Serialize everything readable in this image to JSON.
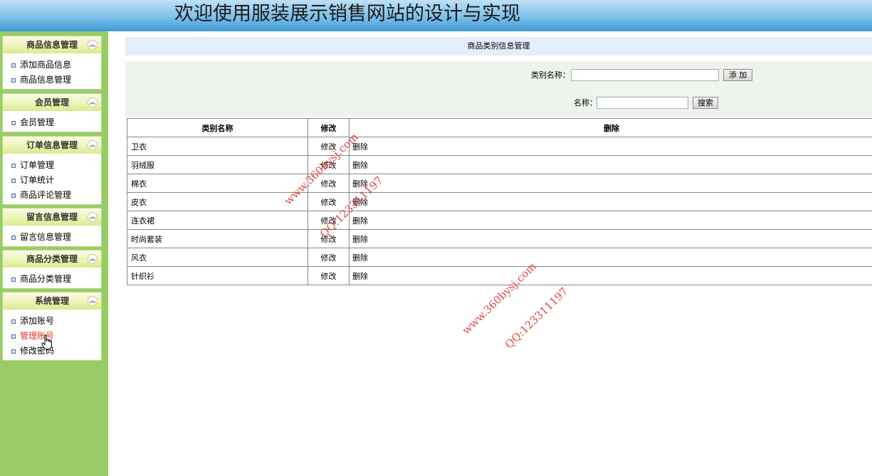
{
  "header": {
    "title": "欢迎使用服装展示销售网站的设计与实现"
  },
  "sidebar": {
    "groups": [
      {
        "title": "商品信息管理",
        "items": [
          "添加商品信息",
          "商品信息管理"
        ]
      },
      {
        "title": "会员管理",
        "items": [
          "会员管理"
        ]
      },
      {
        "title": "订单信息管理",
        "items": [
          "订单管理",
          "订单统计",
          "商品评论管理"
        ]
      },
      {
        "title": "留言信息管理",
        "items": [
          "留言信息管理"
        ]
      },
      {
        "title": "商品分类管理",
        "items": [
          "商品分类管理"
        ]
      },
      {
        "title": "系统管理",
        "items": [
          "添加账号",
          "管理账号",
          "修改密码"
        ]
      }
    ],
    "active_item": "管理账号",
    "collapse_icon": "double-chevron-up-icon"
  },
  "main": {
    "page_title": "商品类别信息管理",
    "add_form": {
      "label": "类别名称：",
      "value": "",
      "button": "添 加"
    },
    "search_form": {
      "label": "名称：",
      "value": "",
      "button": "搜索"
    },
    "table": {
      "headers": [
        "类别名称",
        "修改",
        "删除"
      ],
      "rows": [
        {
          "name": "卫衣",
          "edit": "修改",
          "delete": "删除"
        },
        {
          "name": "羽绒服",
          "edit": "修改",
          "delete": "删除"
        },
        {
          "name": "棉衣",
          "edit": "修改",
          "delete": "删除"
        },
        {
          "name": "皮衣",
          "edit": "修改",
          "delete": "删除"
        },
        {
          "name": "连衣裙",
          "edit": "修改",
          "delete": "删除"
        },
        {
          "name": "时尚套装",
          "edit": "修改",
          "delete": "删除"
        },
        {
          "name": "风衣",
          "edit": "修改",
          "delete": "删除"
        },
        {
          "name": "针织衫",
          "edit": "修改",
          "delete": "删除"
        }
      ]
    }
  },
  "watermarks": [
    "www.360bysj.com",
    "QQ:123311197",
    "www.360bysj.com",
    "QQ:123311197"
  ],
  "colors": {
    "header_blue": "#4ba3dc",
    "sidebar_green": "#99cc66",
    "active_link": "#e03a2a",
    "watermark_red": "#e03333"
  }
}
